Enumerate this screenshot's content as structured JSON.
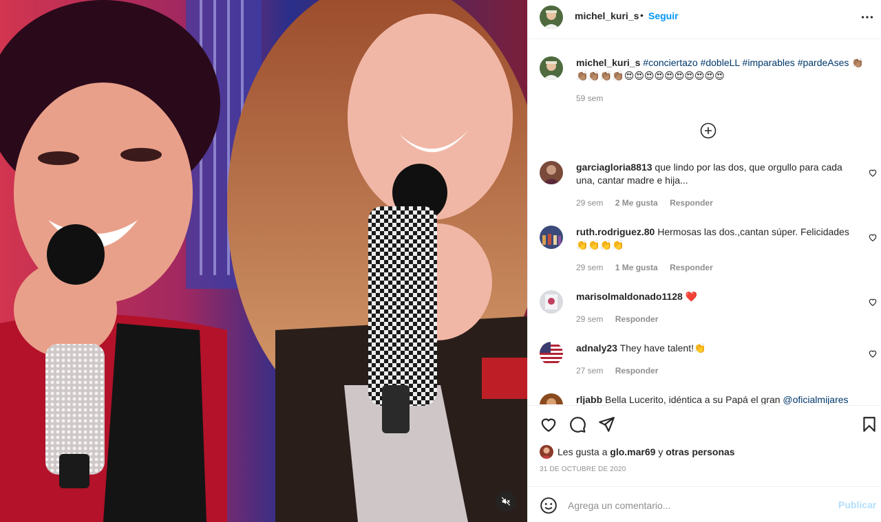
{
  "post": {
    "username": "michel_kuri_s",
    "dot": "•",
    "follow_label": "Seguir",
    "more_icon": "more-horizontal-icon",
    "media_icon": "speaker-muted-icon"
  },
  "caption": {
    "username": "michel_kuri_s",
    "hashtags": [
      "#conciertazo",
      "#dobleLL",
      "#imparables",
      "#pardeAses"
    ],
    "emojis": "👏🏽👏🏽👏🏽👏🏽👏🏽😍😍😍😍😍😍😍😍😍😍",
    "time": "59 sem"
  },
  "comments": [
    {
      "username": "garciagloria8813",
      "text": "que lindo por las dos, que orgullo para cada una, cantar madre e hija...",
      "time": "29 sem",
      "likes": "2 Me gusta",
      "reply": "Responder",
      "avatar_color": "#7a4a3a"
    },
    {
      "username": "ruth.rodriguez.80",
      "text": "Hermosas las dos.,cantan súper. Felicidades 👏👏👏👏",
      "time": "29 sem",
      "likes": "1 Me gusta",
      "reply": "Responder",
      "avatar_color": "#3b4a7a"
    },
    {
      "username": "marisolmaldonado1128",
      "text": "❤️",
      "time": "29 sem",
      "likes": "",
      "reply": "Responder",
      "avatar_color": "#d9dbe0"
    },
    {
      "username": "adnaly23",
      "text": "They have talent!👏",
      "time": "27 sem",
      "likes": "",
      "reply": "Responder",
      "avatar_color": "#b22234"
    },
    {
      "username": "rljabb",
      "text": "Bella Lucerito, idéntica a su Papá el gran",
      "mention": "@oficialmijares",
      "avatar_color": "#8a4a20"
    }
  ],
  "likes": {
    "prefix": "Les gusta a",
    "user": "glo.mar69",
    "connector": "y",
    "others": "otras personas"
  },
  "date": "31 DE OCTUBRE DE 2020",
  "composer": {
    "placeholder": "Agrega un comentario...",
    "publish_label": "Publicar"
  },
  "colors": {
    "accent": "#0095f6",
    "publish_disabled": "#b2dffc",
    "hashtag": "#00376b",
    "muted_text": "#8e8e8e"
  }
}
